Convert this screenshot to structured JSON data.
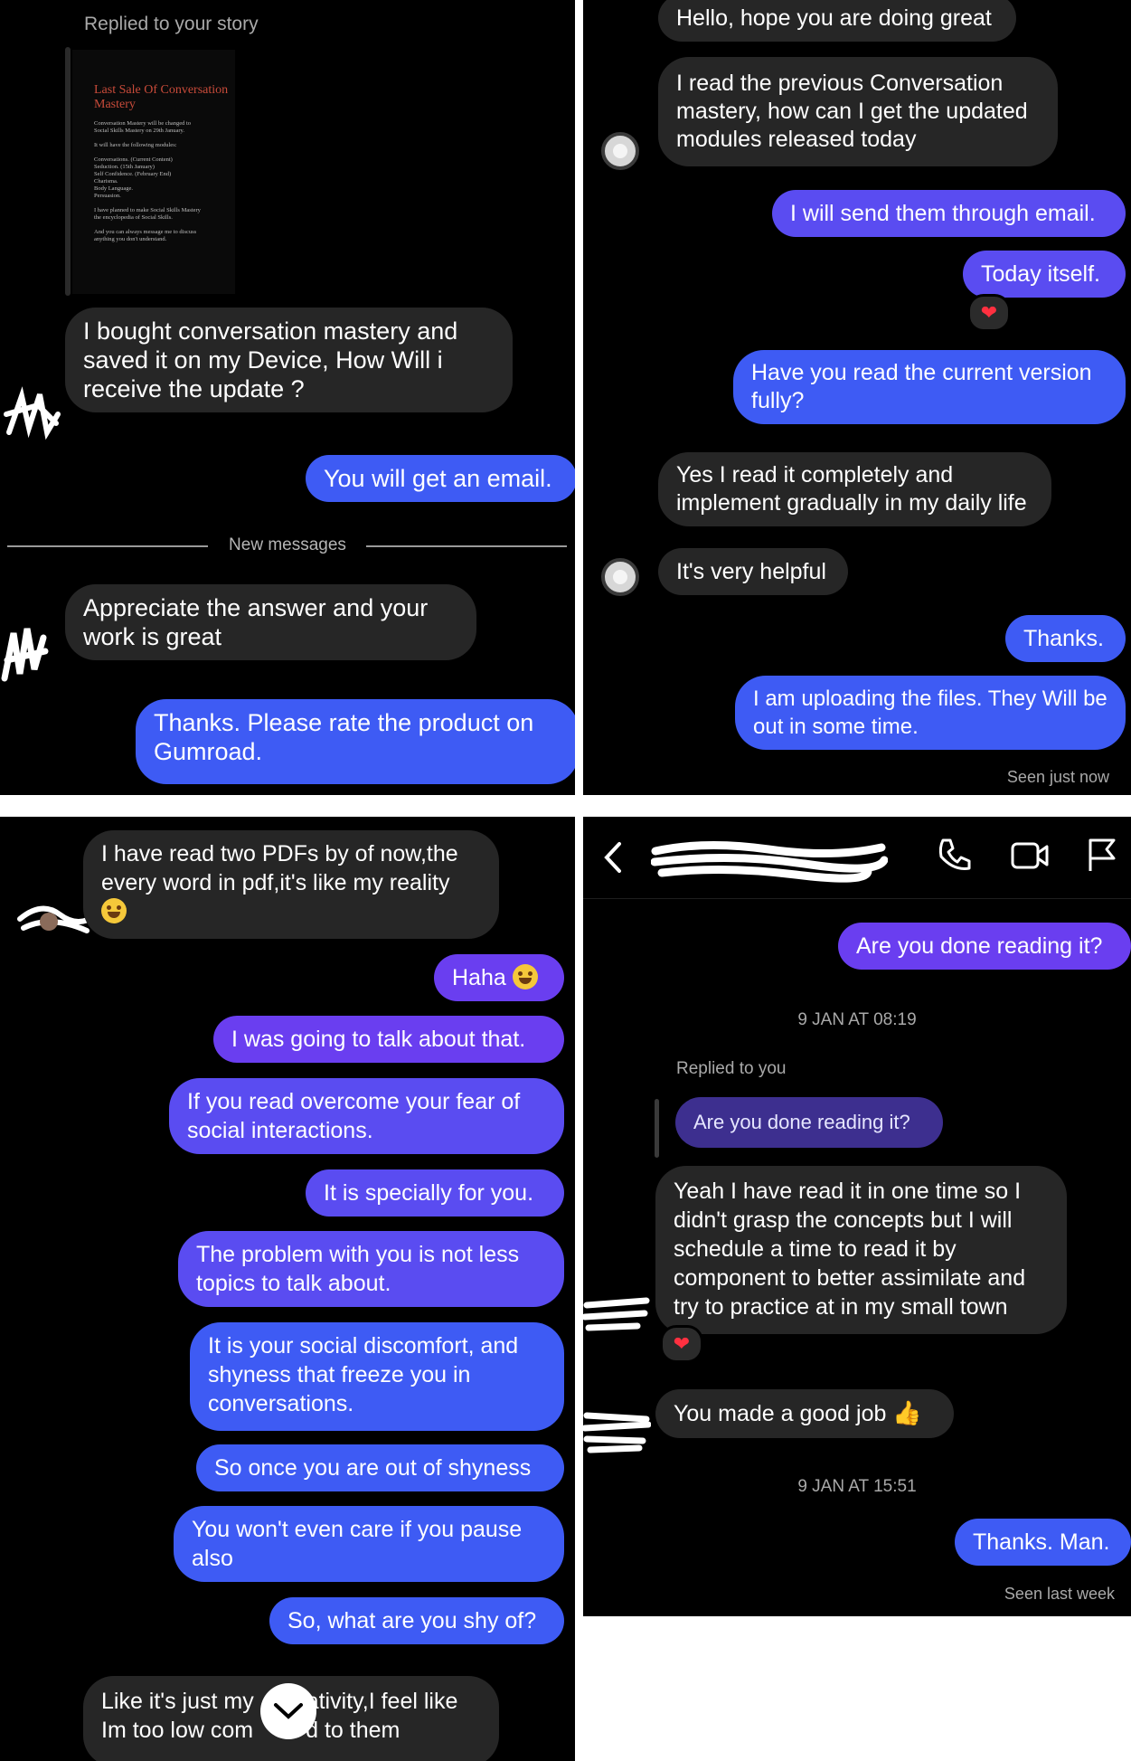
{
  "panel1": {
    "story_header": "Replied to your story",
    "story": {
      "title": "Last Sale Of Conversation Mastery",
      "body": "Conversation Mastery will be changed to\nSocial Skills Mastery on 29th January.\n\nIt will have the following modules:\n\nConversations. (Current Content)\nSeduction. (15th January)\nSelf Confidence. (February End)\nCharisma.\nBody Language.\nPersuasion.\n\nI have planned to make Social Skills Mastery\nthe encyclopedia of Social Skills.\n\nAnd you can always message me to discuss\nanything you don't understand."
    },
    "msg1": "I bought conversation mastery and saved it on my Device, How Will i receive the update ?",
    "msg2": "You will get an email.",
    "new_messages": "New messages",
    "msg3": "Appreciate the answer and your work is great",
    "msg4": "Thanks. Please rate the product on Gumroad."
  },
  "panel2": {
    "msg1": "Hello, hope you are doing great",
    "msg2": "I read the previous Conversation mastery, how can I get the updated modules released today",
    "msg3": "I will send them through email.",
    "msg4": "Today itself.",
    "msg5": "Have you read the current version fully?",
    "msg6": "Yes I read it completely and implement gradually in my daily life",
    "msg7": "It's very helpful",
    "msg8": "Thanks.",
    "msg9": "I am uploading the files. They Will be out in some time.",
    "seen": "Seen just now"
  },
  "panel3": {
    "msg1": "I have read two PDFs by of now,the every word in pdf,it's like my reality",
    "msg2": "Haha",
    "msg3": "I was going to talk about that.",
    "msg4": "If you read overcome your fear of social interactions.",
    "msg5": "It is specially for you.",
    "msg6": "The problem with you is not less topics to talk about.",
    "msg7": "It is your social discomfort, and shyness that freeze you in conversations.",
    "msg8": "So once you are out of shyness",
    "msg9": "You won't even care if you pause also",
    "msg10": "So, what are you shy of?",
    "msg11a": "Like it's just my",
    "msg11b": "ativity,I feel like",
    "msg11c": "Im too low com",
    "msg11d": "d to them"
  },
  "panel4": {
    "msg1": "Are you done reading it?",
    "time1": "9 JAN AT 08:19",
    "replied": "Replied to you",
    "quote": "Are you done reading it?",
    "msg2": "Yeah I have read it in one time so I didn't grasp the concepts but I will schedule a time to read it by component to better assimilate and try to practice at in my small town",
    "msg3": "You made a good job",
    "time2": "9 JAN AT 15:51",
    "msg4": "Thanks. Man.",
    "seen": "Seen last week"
  },
  "icons": {
    "back": "chevron-left-icon",
    "call": "phone-icon",
    "video": "video-camera-icon",
    "report": "flag-icon",
    "scroll": "chevron-down-icon",
    "reaction": "heart-icon"
  },
  "colors": {
    "background": "#000000",
    "incoming": "#262626",
    "outgoing_blue": "#3e5bf4",
    "outgoing_mid": "#5a4cf1",
    "outgoing_purple": "#6a3ef0",
    "heart": "#ff3040"
  }
}
